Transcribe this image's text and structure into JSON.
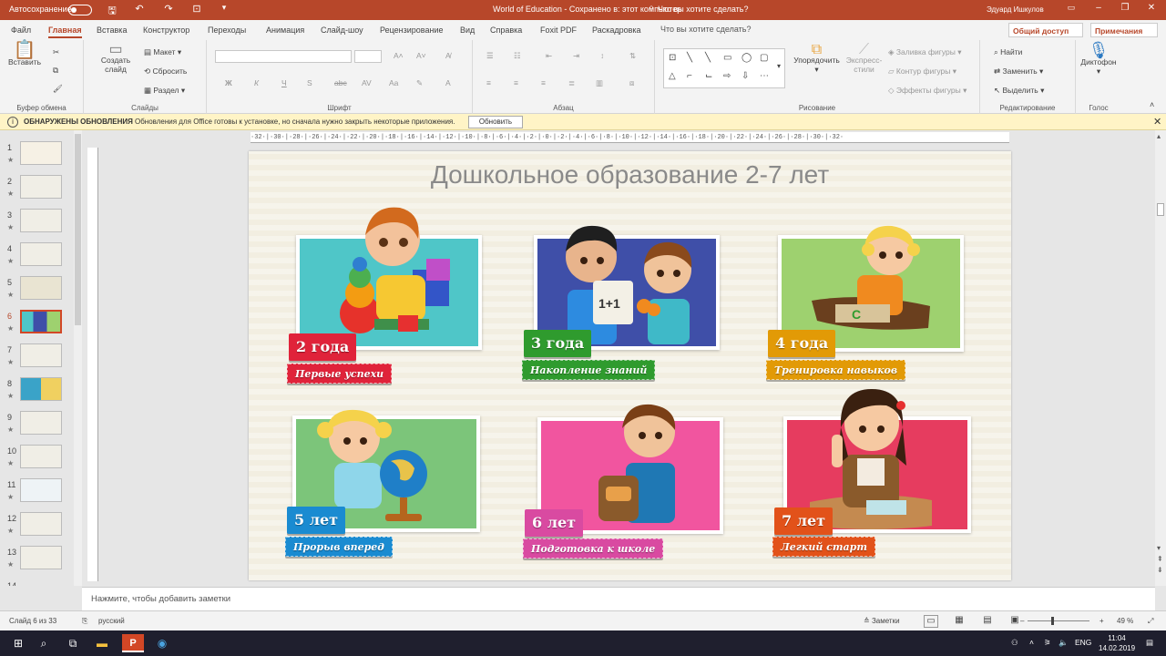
{
  "titlebar": {
    "autosave": "Автосохранение",
    "doc_title": "World of Education  -  Сохранено в: этот компьютер",
    "search": "Что вы хотите сделать?",
    "user": "Эдуард Ишкулов"
  },
  "tabs": [
    "Файл",
    "Главная",
    "Вставка",
    "Конструктор",
    "Переходы",
    "Анимация",
    "Слайд-шоу",
    "Рецензирование",
    "Вид",
    "Справка",
    "Foxit PDF",
    "Раскадровка"
  ],
  "share": "Общий доступ",
  "comments": "Примечания",
  "ribbon": {
    "clipboard": {
      "label": "Буфер обмена",
      "paste": "Вставить"
    },
    "slides": {
      "label": "Слайды",
      "create": "Создать",
      "create2": "слайд",
      "layout": "Макет",
      "reset": "Сбросить",
      "section": "Раздел"
    },
    "font": {
      "label": "Шрифт"
    },
    "paragraph": {
      "label": "Абзац"
    },
    "drawing": {
      "label": "Рисование",
      "arrange": "Упорядочить",
      "styles1": "Экспресс-",
      "styles2": "стили",
      "fill": "Заливка фигуры",
      "outline": "Контур фигуры",
      "effects": "Эффекты фигуры"
    },
    "editing": {
      "label": "Редактирование",
      "find": "Найти",
      "replace": "Заменить",
      "select": "Выделить"
    },
    "voice": {
      "label": "Голос",
      "dictate": "Диктофон"
    }
  },
  "notification": {
    "title": "ОБНАРУЖЕНЫ ОБНОВЛЕНИЯ",
    "message": "Обновления для Office готовы к установке, но сначала нужно закрыть некоторые приложения.",
    "button": "Обновить"
  },
  "thumbnails": [
    "1",
    "2",
    "3",
    "4",
    "5",
    "6",
    "7",
    "8",
    "9",
    "10",
    "11",
    "12",
    "13",
    "14"
  ],
  "ruler_text": "·32·|·30·|·28·|·26·|·24·|·22·|·20·|·18·|·16·|·14·|·12·|·10·|·8·|·6·|·4·|·2·|·0·|·2·|·4·|·6·|·8·|·10·|·12·|·14·|·16·|·18·|·20·|·22·|·24·|·26·|·28·|·30·|·32·",
  "slide": {
    "title": "Дошкольное образование 2-7 лет",
    "cards": [
      {
        "age": "2 года",
        "caption": "Первые успехи",
        "color": "#e0233a",
        "bg": "#4fc6c8"
      },
      {
        "age": "3 года",
        "caption": "Накопление знаний",
        "color": "#2f9b2e",
        "bg": "#3f4fa8"
      },
      {
        "age": "4 года",
        "caption": "Тренировка навыков",
        "color": "#e29a06",
        "bg": "#9ed16f"
      },
      {
        "age": "5 лет",
        "caption": "Прорыв вперед",
        "color": "#1a8bd1",
        "bg": "#7cc57a"
      },
      {
        "age": "6 лет",
        "caption": "Подготовка к школе",
        "color": "#d94aa1",
        "bg": "#f1559f"
      },
      {
        "age": "7 лет",
        "caption": "Легкий старт",
        "color": "#e2521a",
        "bg": "#e63c5f"
      }
    ]
  },
  "notes": "Нажмите, чтобы добавить заметки",
  "status": {
    "slide": "Слайд 6 из 33",
    "lang": "русский",
    "notes_btn": "Заметки",
    "zoom": "49 %"
  },
  "taskbar": {
    "lang": "ENG",
    "time": "11:04",
    "date": "14.02.2019"
  }
}
